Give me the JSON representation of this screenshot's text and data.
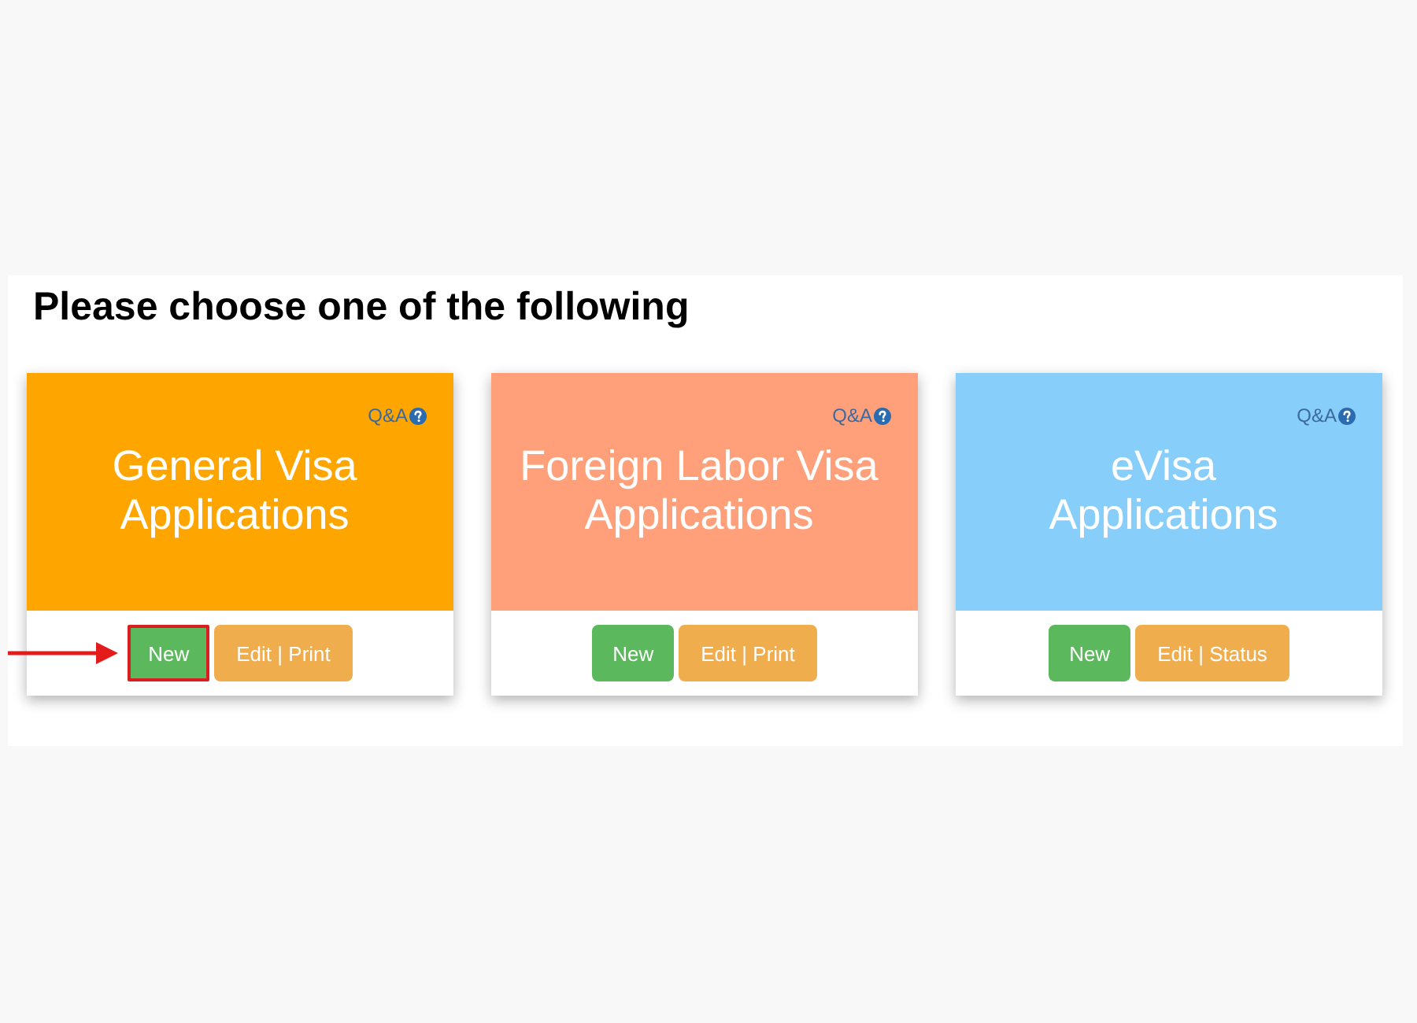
{
  "heading": "Please choose one of the following",
  "cards": [
    {
      "title_lines": [
        "General Visa",
        "Applications"
      ],
      "color": "#ffa500",
      "help_link": "Q&A",
      "buttons": [
        {
          "label": "New",
          "kind": "new",
          "highlighted": true
        },
        {
          "label": "Edit | Print",
          "kind": "edit",
          "highlighted": false
        }
      ]
    },
    {
      "title_lines": [
        "Foreign Labor Visa",
        "Applications"
      ],
      "color": "#ffa07a",
      "help_link": "Q&A",
      "buttons": [
        {
          "label": "New",
          "kind": "new",
          "highlighted": false
        },
        {
          "label": "Edit | Print",
          "kind": "edit",
          "highlighted": false
        }
      ]
    },
    {
      "title_lines": [
        "eVisa",
        "Applications"
      ],
      "color": "#87cefa",
      "help_link": "Q&A",
      "buttons": [
        {
          "label": "New",
          "kind": "new",
          "highlighted": false
        },
        {
          "label": "Edit | Status",
          "kind": "edit",
          "highlighted": false
        }
      ]
    }
  ]
}
